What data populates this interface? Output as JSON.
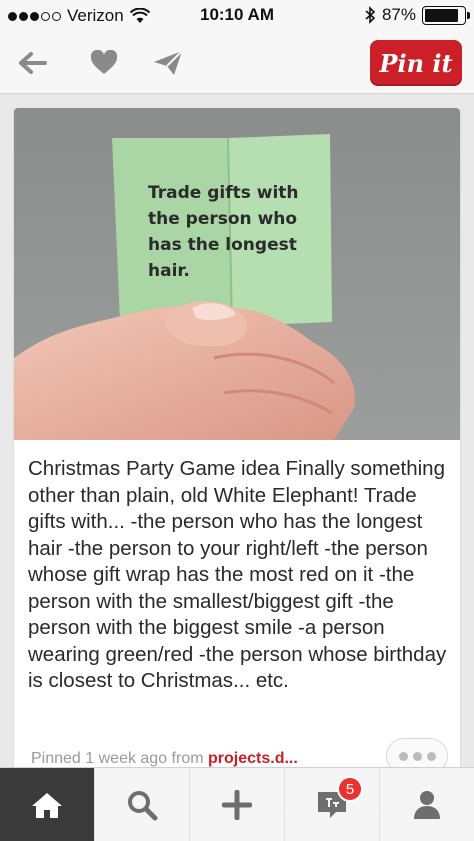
{
  "status_bar": {
    "carrier": "Verizon",
    "time": "10:10 AM",
    "battery": "87%",
    "battery_level": 0.87
  },
  "toolbar": {
    "back_icon": "arrow-left-icon",
    "like_icon": "heart-icon",
    "send_icon": "paper-plane-icon",
    "pin_button_label": "Pin it"
  },
  "pin": {
    "image_text": [
      "Trade gifts with",
      "the person who",
      "has the longest",
      "hair."
    ],
    "description": "Christmas Party Game idea Finally something other than plain, old White Elephant! Trade gifts with... -the person who has the longest hair -the person to your right/left -the person whose gift wrap has the most red on it -the person with the smallest/biggest gift -the person with the biggest smile -a person wearing green/red -the person whose birthday is closest to Christmas... etc.",
    "pinned_prefix": "Pinned 1 week ago from ",
    "source": "projects.d..."
  },
  "tabbar": {
    "tabs": [
      "home-icon",
      "search-icon",
      "add-icon",
      "notifications-icon",
      "profile-icon"
    ],
    "notification_count": "5"
  },
  "colors": {
    "brand_red": "#cb2027",
    "tab_active_bg": "#3a3a3a",
    "badge": "#e8332e"
  }
}
